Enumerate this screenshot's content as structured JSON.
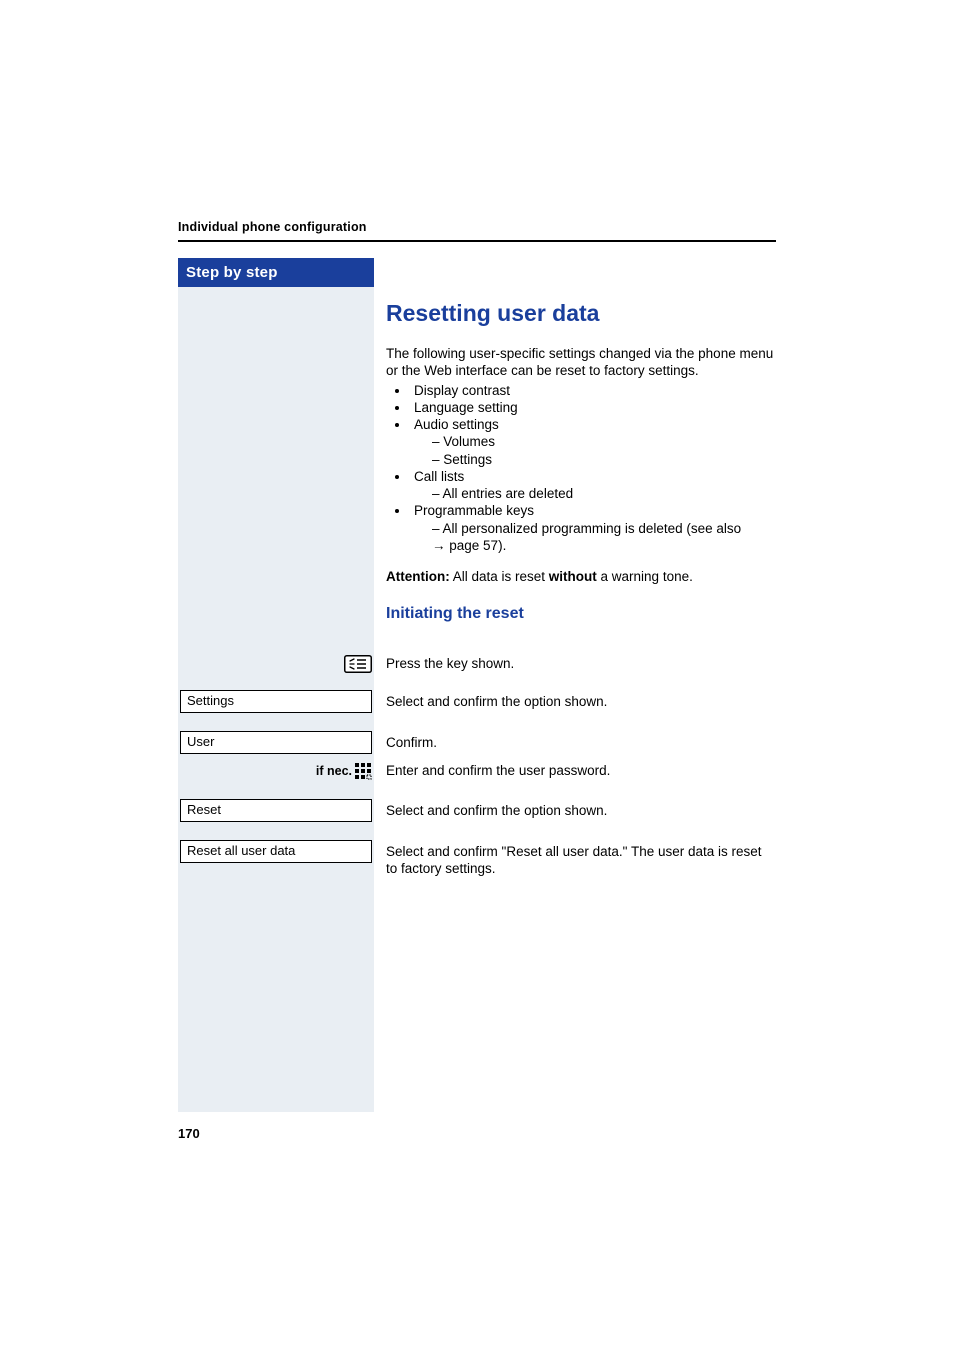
{
  "header": {
    "running_title": "Individual phone configuration"
  },
  "sidebar": {
    "title": "Step by step"
  },
  "section": {
    "title": "Resetting user data",
    "intro": "The following user-specific settings changed via the phone menu or the Web interface can be reset to factory settings.",
    "bullets": {
      "b1": "Display contrast",
      "b2": "Language setting",
      "b3": "Audio settings",
      "b3a": "Volumes",
      "b3b": "Settings",
      "b4": "Call lists",
      "b4a": "All entries are deleted",
      "b5": "Programmable keys",
      "b5a_prefix": "All personalized programming is deleted (see also ",
      "b5a_pageref": "page 57",
      "b5a_suffix": ")."
    },
    "attention_label": "Attention:",
    "attention_pre": " All data is reset ",
    "attention_bold": "without",
    "attention_post": " a warning tone."
  },
  "subsection": {
    "title": "Initiating the reset"
  },
  "steps": [
    {
      "left_type": "icon-menu",
      "right": "Press the key shown."
    },
    {
      "left_type": "box",
      "left_text": "Settings",
      "right": "Select and confirm the option shown."
    },
    {
      "left_type": "box",
      "left_text": "User",
      "right": "Confirm."
    },
    {
      "left_type": "icon-keypad",
      "left_label": "if nec.",
      "right": "Enter and confirm the user password."
    },
    {
      "left_type": "box",
      "left_text": "Reset",
      "right": "Select and confirm the option shown."
    },
    {
      "left_type": "box",
      "left_text": "Reset all user data",
      "right": "Select and confirm \"Reset all user data.\" The user data is reset to factory settings."
    }
  ],
  "page_number": "170"
}
